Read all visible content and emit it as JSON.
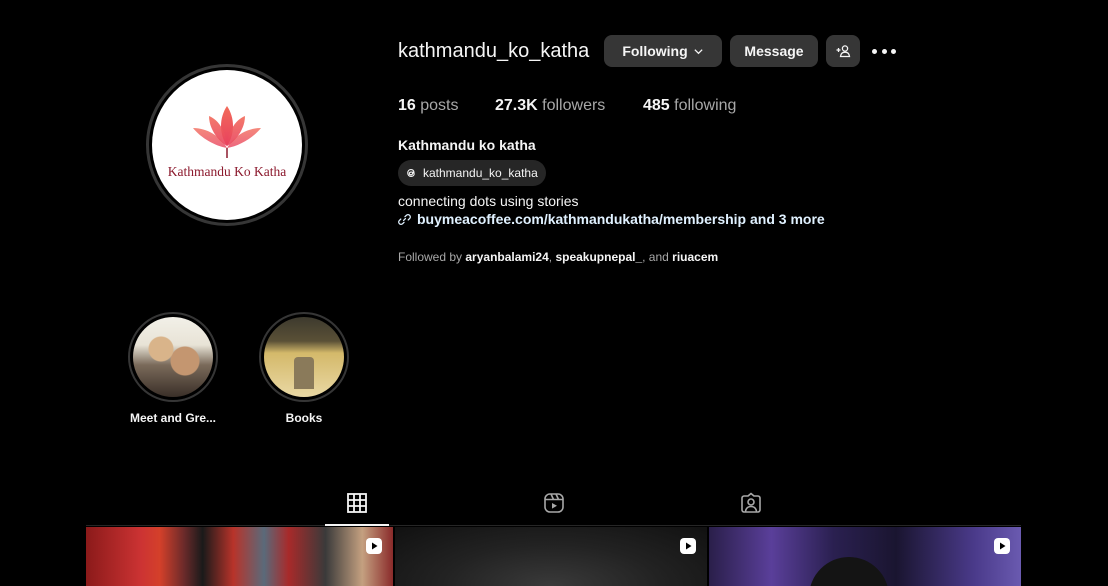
{
  "profile": {
    "username": "kathmandu_ko_katha",
    "avatar_text": "Kathmandu Ko Katha",
    "full_name": "Kathmandu ko katha",
    "threads_handle": "kathmandu_ko_katha",
    "bio": "connecting dots using stories",
    "link_text": "buymeacoffee.com/kathmandukatha/membership and 3 more"
  },
  "actions": {
    "following_label": "Following",
    "message_label": "Message"
  },
  "stats": {
    "posts_count": "16",
    "posts_label": "posts",
    "followers_count": "27.3K",
    "followers_label": "followers",
    "following_count": "485",
    "following_label": "following"
  },
  "followed_by": {
    "prefix": "Followed by",
    "users": [
      "aryanbalami24",
      "speakupnepal_",
      "riuacem"
    ],
    "sep1": ", ",
    "sep2": ", and "
  },
  "highlights": [
    {
      "label": "Meet and Gre..."
    },
    {
      "label": "Books"
    }
  ],
  "tabs": [
    {
      "icon": "grid-icon",
      "active": true
    },
    {
      "icon": "reels-icon",
      "active": false
    },
    {
      "icon": "tagged-icon",
      "active": false
    }
  ],
  "colors": {
    "background": "#000000",
    "button_bg": "#363636",
    "muted_text": "#a8a8a8",
    "link_text": "#e0f1ff",
    "logo_red": "#8c1a2e"
  }
}
